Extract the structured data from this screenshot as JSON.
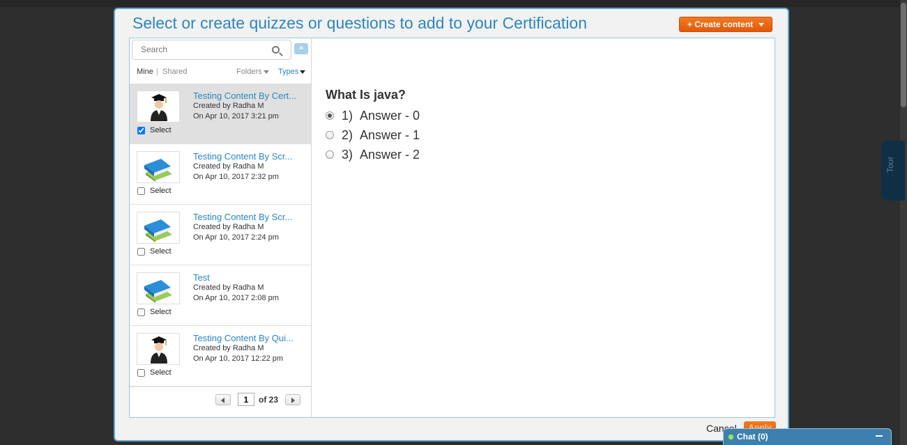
{
  "modal": {
    "title": "Select or create quizzes or questions to add to your Certification",
    "create_button_label": "+ Create content"
  },
  "search": {
    "placeholder": "Search"
  },
  "expand_button_label": "»",
  "filters": {
    "mine": "Mine",
    "separator": "|",
    "shared": "Shared",
    "folders": "Folders",
    "types": "Types"
  },
  "items": [
    {
      "title": "Testing Content By Cert...",
      "created_by": "Created by Radha M",
      "date": "On Apr 10, 2017 3:21 pm",
      "select_label": "Select",
      "checked": true,
      "icon": "graduate-icon"
    },
    {
      "title": "Testing Content By Scr...",
      "created_by": "Created by Radha M",
      "date": "On Apr 10, 2017 2:32 pm",
      "select_label": "Select",
      "checked": false,
      "icon": "books-icon"
    },
    {
      "title": "Testing Content By Scr...",
      "created_by": "Created by Radha M",
      "date": "On Apr 10, 2017 2:24 pm",
      "select_label": "Select",
      "checked": false,
      "icon": "books-icon"
    },
    {
      "title": "Test",
      "created_by": "Created by Radha M",
      "date": "On Apr 10, 2017 2:08 pm",
      "select_label": "Select",
      "checked": false,
      "icon": "books-icon"
    },
    {
      "title": "Testing Content By Qui...",
      "created_by": "Created by Radha M",
      "date": "On Apr 10, 2017 12:22 pm",
      "select_label": "Select",
      "checked": false,
      "icon": "graduate-icon"
    }
  ],
  "pager": {
    "page": "1",
    "of_label": "of 23"
  },
  "question": {
    "title": "What Is java?",
    "answers": [
      {
        "num": "1)",
        "text": "Answer - 0",
        "selected": true
      },
      {
        "num": "2)",
        "text": "Answer - 1",
        "selected": false
      },
      {
        "num": "3)",
        "text": "Answer - 2",
        "selected": false
      }
    ]
  },
  "footer": {
    "cancel_label": "Cancel",
    "apply_label": "Apply"
  },
  "chat": {
    "label": "Chat  (0)"
  },
  "tour": {
    "label": "Tour"
  },
  "colors": {
    "accent_blue": "#2a86bf",
    "brand_orange": "#e8620f",
    "chat_blue": "#3d7fae"
  }
}
